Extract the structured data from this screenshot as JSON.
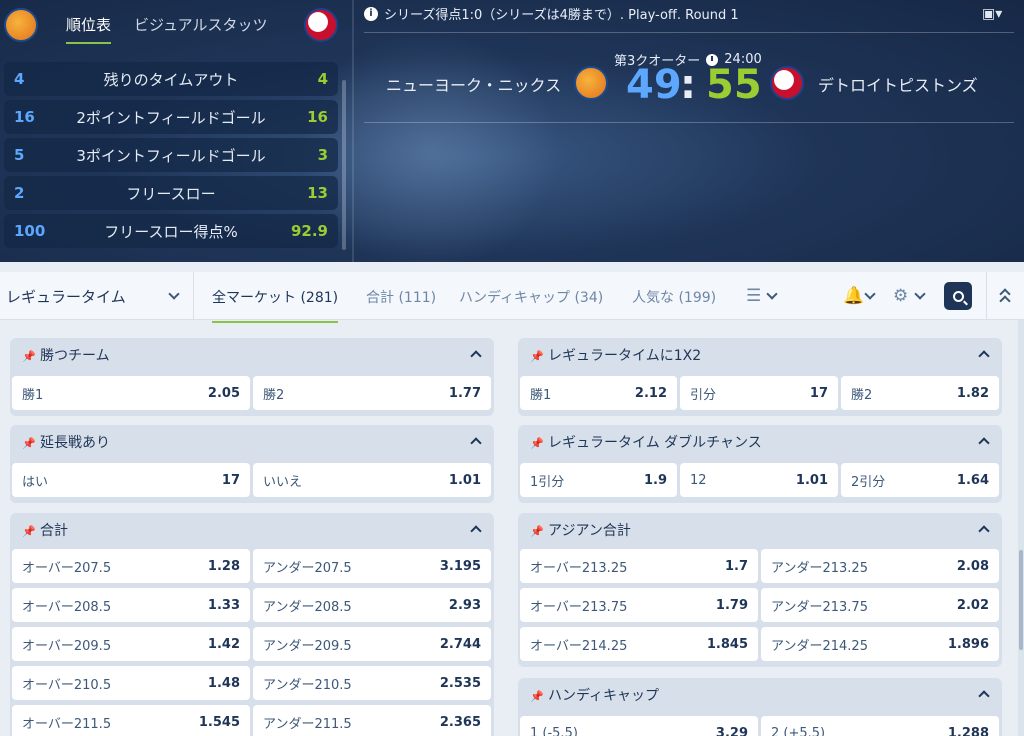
{
  "left_panel": {
    "tabs": [
      "順位表",
      "ビジュアルスタッツ"
    ],
    "stats": [
      {
        "home": "4",
        "label": "残りのタイムアウト",
        "away": "4"
      },
      {
        "home": "16",
        "label": "2ポイントフィールドゴール",
        "away": "16"
      },
      {
        "home": "5",
        "label": "3ポイントフィールドゴール",
        "away": "3"
      },
      {
        "home": "2",
        "label": "フリースロー",
        "away": "13"
      },
      {
        "home": "100",
        "label": "フリースロー得点%",
        "away": "92.9"
      }
    ]
  },
  "scoreboard": {
    "info": "シリーズ得点1:0（シリーズは4勝まで）. Play-off. Round 1",
    "period": "第3クオーター",
    "clock": "24:00",
    "home_team": "ニューヨーク・ニックス",
    "away_team": "デトロイトピストンズ",
    "home_score": "49",
    "separator": ":",
    "away_score": "55"
  },
  "nav": {
    "period_select": "レギュラータイム",
    "tabs": [
      "全マーケット (281)",
      "合計 (111)",
      "ハンディキャップ (34)",
      "人気な (199)"
    ]
  },
  "markets": {
    "winner": {
      "title": "勝つチーム",
      "odds": [
        [
          "勝1",
          "2.05"
        ],
        [
          "勝2",
          "1.77"
        ]
      ]
    },
    "reg1x2": {
      "title": "レギュラータイムに1X2",
      "odds": [
        [
          "勝1",
          "2.12"
        ],
        [
          "引分",
          "17"
        ],
        [
          "勝2",
          "1.82"
        ]
      ]
    },
    "overtime": {
      "title": "延長戦あり",
      "odds": [
        [
          "はい",
          "17"
        ],
        [
          "いいえ",
          "1.01"
        ]
      ]
    },
    "double_chance": {
      "title": "レギュラータイム ダブルチャンス",
      "odds": [
        [
          "1引分",
          "1.9"
        ],
        [
          "12",
          "1.01"
        ],
        [
          "2引分",
          "1.64"
        ]
      ]
    },
    "total": {
      "title": "合計",
      "odds": [
        [
          "オーバー207.5",
          "1.28",
          "アンダー207.5",
          "3.195"
        ],
        [
          "オーバー208.5",
          "1.33",
          "アンダー208.5",
          "2.93"
        ],
        [
          "オーバー209.5",
          "1.42",
          "アンダー209.5",
          "2.744"
        ],
        [
          "オーバー210.5",
          "1.48",
          "アンダー210.5",
          "2.535"
        ],
        [
          "オーバー211.5",
          "1.545",
          "アンダー211.5",
          "2.365"
        ]
      ]
    },
    "asian_total": {
      "title": "アジアン合計",
      "odds": [
        [
          "オーバー213.25",
          "1.7",
          "アンダー213.25",
          "2.08"
        ],
        [
          "オーバー213.75",
          "1.79",
          "アンダー213.75",
          "2.02"
        ],
        [
          "オーバー214.25",
          "1.845",
          "アンダー214.25",
          "1.896"
        ]
      ]
    },
    "handicap": {
      "title": "ハンディキャップ",
      "odds": [
        [
          "1 (-5.5)",
          "3.29",
          "2 (+5.5)",
          "1.288"
        ]
      ]
    }
  },
  "colors": {
    "home": "#5ea7ff",
    "away": "#9acd32",
    "accent": "#8bc34a",
    "navy": "#1f3558"
  }
}
